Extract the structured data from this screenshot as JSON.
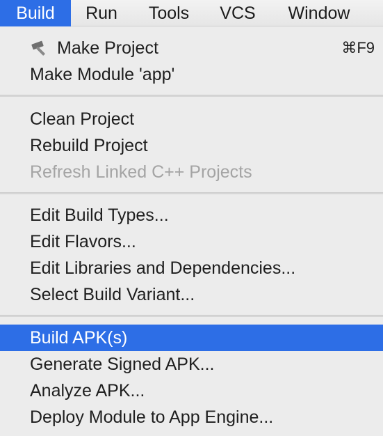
{
  "menubar": {
    "items": [
      {
        "label": "Build",
        "active": true
      },
      {
        "label": "Run"
      },
      {
        "label": "Tools"
      },
      {
        "label": "VCS"
      },
      {
        "label": "Window"
      }
    ]
  },
  "menu": {
    "groups": [
      {
        "items": [
          {
            "label": "Make Project",
            "shortcut": "⌘F9",
            "icon": "hammer-icon"
          },
          {
            "label": "Make Module 'app'"
          }
        ]
      },
      {
        "items": [
          {
            "label": "Clean Project"
          },
          {
            "label": "Rebuild Project"
          },
          {
            "label": "Refresh Linked C++ Projects",
            "disabled": true
          }
        ]
      },
      {
        "items": [
          {
            "label": "Edit Build Types..."
          },
          {
            "label": "Edit Flavors..."
          },
          {
            "label": "Edit Libraries and Dependencies..."
          },
          {
            "label": "Select Build Variant..."
          }
        ]
      },
      {
        "items": [
          {
            "label": "Build APK(s)",
            "selected": true
          },
          {
            "label": "Generate Signed APK..."
          },
          {
            "label": "Analyze APK..."
          },
          {
            "label": "Deploy Module to App Engine..."
          }
        ]
      }
    ]
  },
  "colors": {
    "selection": "#2d6ee6",
    "menu_background": "#ececec",
    "disabled_text": "#a4a4a4"
  }
}
